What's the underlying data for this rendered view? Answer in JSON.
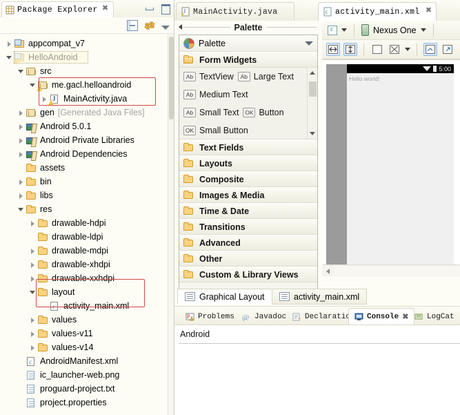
{
  "package_explorer": {
    "view_title": "Package Explorer",
    "view_icon": "package-explorer-icon",
    "toolbar": {
      "collapse_all": "collapse-all-icon",
      "link_with_editor": "link-with-editor-icon",
      "view_menu": "view-menu-icon"
    },
    "window_buttons": {
      "minimize": "minimize-icon",
      "maximize": "maximize-icon"
    },
    "tree": [
      {
        "label": "appcompat_v7",
        "icon": "java-project-icon",
        "indent": 0,
        "arrow": "closed"
      },
      {
        "label": "HelloAndroid",
        "icon": "android-project-icon",
        "indent": 0,
        "arrow": "open",
        "selected": true
      },
      {
        "label": "src",
        "icon": "source-folder-icon",
        "indent": 1,
        "arrow": "open"
      },
      {
        "label": "me.gacl.helloandroid",
        "icon": "package-icon",
        "indent": 2,
        "arrow": "open",
        "highlighted": true
      },
      {
        "label": "MainActivity.java",
        "icon": "java-file-icon",
        "indent": 3,
        "arrow": "closed",
        "highlighted": true
      },
      {
        "label": "gen",
        "suffix": "[Generated Java Files]",
        "icon": "source-folder-icon",
        "indent": 1,
        "arrow": "closed"
      },
      {
        "label": "Android 5.0.1",
        "icon": "library-icon",
        "indent": 1,
        "arrow": "closed"
      },
      {
        "label": "Android Private Libraries",
        "icon": "library-icon",
        "indent": 1,
        "arrow": "closed"
      },
      {
        "label": "Android Dependencies",
        "icon": "library-icon",
        "indent": 1,
        "arrow": "closed"
      },
      {
        "label": "assets",
        "icon": "folder-icon",
        "indent": 1,
        "arrow": "none"
      },
      {
        "label": "bin",
        "icon": "folder-icon",
        "indent": 1,
        "arrow": "closed"
      },
      {
        "label": "libs",
        "icon": "folder-icon",
        "indent": 1,
        "arrow": "closed"
      },
      {
        "label": "res",
        "icon": "folder-icon",
        "indent": 1,
        "arrow": "open"
      },
      {
        "label": "drawable-hdpi",
        "icon": "folder-icon",
        "indent": 2,
        "arrow": "closed"
      },
      {
        "label": "drawable-ldpi",
        "icon": "folder-icon",
        "indent": 2,
        "arrow": "none"
      },
      {
        "label": "drawable-mdpi",
        "icon": "folder-icon",
        "indent": 2,
        "arrow": "closed"
      },
      {
        "label": "drawable-xhdpi",
        "icon": "folder-icon",
        "indent": 2,
        "arrow": "closed"
      },
      {
        "label": "drawable-xxhdpi",
        "icon": "folder-icon",
        "indent": 2,
        "arrow": "closed"
      },
      {
        "label": "layout",
        "icon": "folder-icon",
        "indent": 2,
        "arrow": "open",
        "highlighted": true
      },
      {
        "label": "activity_main.xml",
        "icon": "xml-file-icon",
        "indent": 3,
        "arrow": "none",
        "highlighted": true
      },
      {
        "label": "values",
        "icon": "folder-icon",
        "indent": 2,
        "arrow": "closed"
      },
      {
        "label": "values-v11",
        "icon": "folder-icon",
        "indent": 2,
        "arrow": "closed"
      },
      {
        "label": "values-v14",
        "icon": "folder-icon",
        "indent": 2,
        "arrow": "closed"
      },
      {
        "label": "AndroidManifest.xml",
        "icon": "xml-file-icon",
        "indent": 1,
        "arrow": "none"
      },
      {
        "label": "ic_launcher-web.png",
        "icon": "png-file-icon",
        "indent": 1,
        "arrow": "none"
      },
      {
        "label": "proguard-project.txt",
        "icon": "text-file-icon",
        "indent": 1,
        "arrow": "none"
      },
      {
        "label": "project.properties",
        "icon": "properties-file-icon",
        "indent": 1,
        "arrow": "none"
      }
    ]
  },
  "editor": {
    "tabs": [
      {
        "label": "MainActivity.java",
        "icon": "java-file-icon",
        "active": false
      },
      {
        "label": "activity_main.xml",
        "icon": "xml-file-icon",
        "active": true,
        "close": "✖"
      }
    ]
  },
  "palette": {
    "section_title": "Palette",
    "header_label": "Palette",
    "header_icon": "palette-icon",
    "categories": [
      {
        "label": "Form Widgets",
        "expanded": true
      },
      {
        "label": "Text Fields",
        "expanded": false
      },
      {
        "label": "Layouts",
        "expanded": false
      },
      {
        "label": "Composite",
        "expanded": false
      },
      {
        "label": "Images & Media",
        "expanded": false
      },
      {
        "label": "Time & Date",
        "expanded": false
      },
      {
        "label": "Transitions",
        "expanded": false
      },
      {
        "label": "Advanced",
        "expanded": false
      },
      {
        "label": "Other",
        "expanded": false
      },
      {
        "label": "Custom & Library Views",
        "expanded": false
      }
    ],
    "form_widgets": [
      [
        {
          "label": "TextView",
          "glyph": "Ab"
        },
        {
          "label": "Large Text",
          "glyph": "Ab"
        }
      ],
      [
        {
          "label": "Medium Text",
          "glyph": "Ab"
        }
      ],
      [
        {
          "label": "Small Text",
          "glyph": "Ab"
        },
        {
          "label": "Button",
          "glyph": "OK"
        }
      ],
      [
        {
          "label": "Small Button",
          "glyph": "OK"
        }
      ]
    ]
  },
  "layout_editor": {
    "tabs": [
      {
        "label": "Graphical Layout",
        "active": true,
        "icon": "graphical-layout-icon"
      },
      {
        "label": "activity_main.xml",
        "active": false,
        "icon": "xml-source-icon"
      }
    ],
    "toolbar": {
      "config_icon": "xml-config-icon",
      "device_label": "Nexus One",
      "device_icon": "phone-icon",
      "buttons": [
        "fit-width-icon",
        "fit-height-icon",
        "zoom-normal-icon",
        "zoom-fit-icon",
        "refresh-icon",
        "export-icon"
      ]
    },
    "preview": {
      "status_time": "5:00",
      "wifi_icon": "wifi-icon",
      "battery_icon": "battery-icon",
      "content_text": "Hello world!"
    }
  },
  "console": {
    "tabs": [
      {
        "label": "Problems",
        "icon": "problems-icon",
        "active": false
      },
      {
        "label": "Javadoc",
        "icon": "javadoc-icon",
        "active": false
      },
      {
        "label": "Declaration",
        "icon": "declaration-icon",
        "active": false
      },
      {
        "label": "Console",
        "icon": "console-icon",
        "active": true,
        "close": "✖"
      },
      {
        "label": "LogCat",
        "icon": "logcat-icon",
        "active": false
      }
    ],
    "body_text": "Android"
  },
  "colors": {
    "highlight_red": "#cf4a45",
    "tab_active_bg": "#ffffff",
    "panel_bg": "#fdfdf6",
    "accent_blue": "#d9ebfb"
  }
}
